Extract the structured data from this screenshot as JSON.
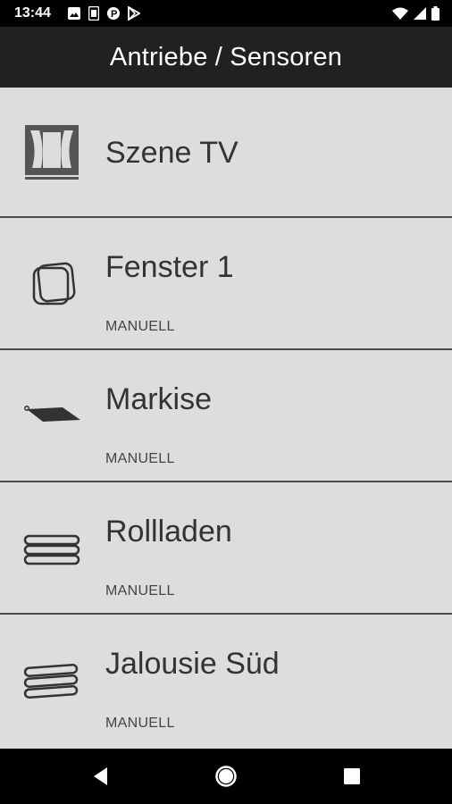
{
  "status_bar": {
    "time": "13:44",
    "left_icons": [
      "image-icon",
      "sim-icon",
      "parking-icon",
      "play-store-icon"
    ],
    "right_icons": [
      "wifi-icon",
      "signal-icon",
      "battery-icon"
    ]
  },
  "app_bar": {
    "title": "Antriebe / Sensoren"
  },
  "items": [
    {
      "title": "Szene TV",
      "subtitle": "",
      "icon": "curtain-scene-icon"
    },
    {
      "title": "Fenster 1",
      "subtitle": "MANUELL",
      "icon": "window-icon"
    },
    {
      "title": "Markise",
      "subtitle": "MANUELL",
      "icon": "awning-icon"
    },
    {
      "title": "Rollladen",
      "subtitle": "MANUELL",
      "icon": "roller-shutter-icon"
    },
    {
      "title": "Jalousie Süd",
      "subtitle": "MANUELL",
      "icon": "blinds-icon"
    }
  ],
  "nav_bar": {
    "buttons": [
      "back-icon",
      "home-icon",
      "recents-icon"
    ]
  },
  "colors": {
    "app_bar": "#212121",
    "list_background": "#dddddd",
    "divider": "#4a4a4a",
    "text": "#333333"
  }
}
